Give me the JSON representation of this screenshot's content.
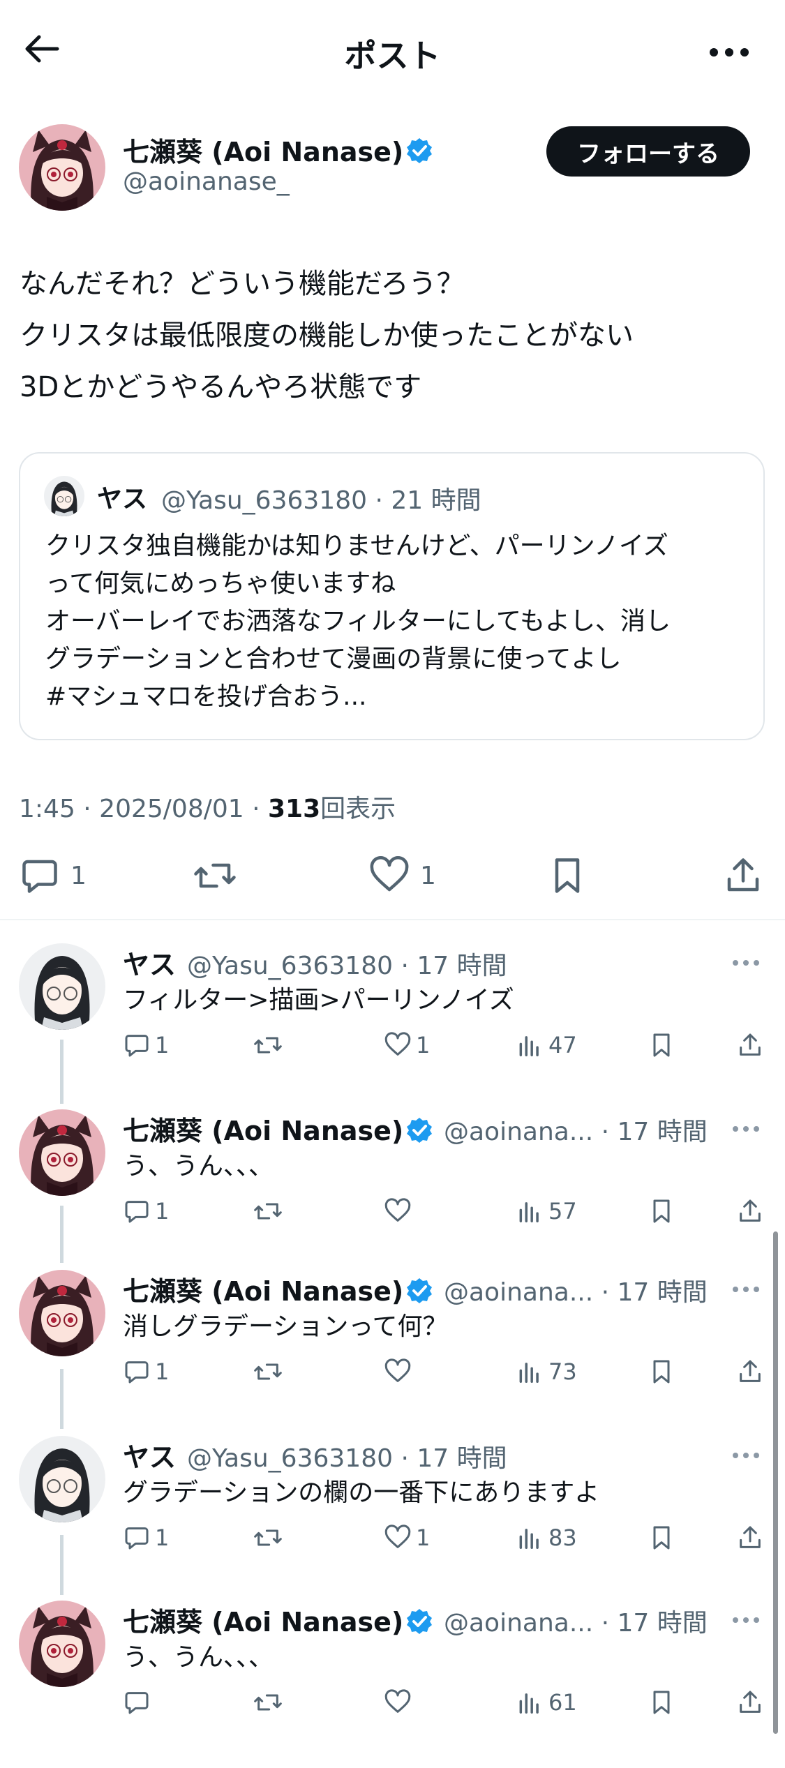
{
  "header": {
    "title": "ポスト",
    "back_icon": "arrow-left-icon",
    "more_icon": "more-horizontal-icon"
  },
  "main_post": {
    "author_name": "七瀬葵 (Aoi Nanase)",
    "handle": "@aoinanase_",
    "follow_label": "フォローする",
    "text_lines": [
      "なんだそれ？どういう機能だろう？",
      "クリスタは最低限度の機能しか使ったことがない",
      "3Dとかどうやるんやろ状態です"
    ],
    "quote": {
      "author_name": "ヤス",
      "handle_time": "@Yasu_6363180 · 21 時間",
      "text_lines": [
        "クリスタ独自機能かは知りませんけど、パーリンノイズ",
        "って何気にめっちゃ使いますね",
        "オーバーレイでお洒落なフィルターにしてもよし、消し",
        "グラデーションと合わせて漫画の背景に使ってよし",
        "#マシュマロを投げ合おう..."
      ]
    },
    "meta_time": "1:45 · 2025/08/01 · ",
    "meta_views": "313",
    "meta_views_label": "回表示",
    "stats": {
      "replies": "1",
      "likes": "1"
    }
  },
  "replies": [
    {
      "author_name": "ヤス",
      "verified": false,
      "handle_time": "@Yasu_6363180 · 17 時間",
      "text": "フィルター>描画>パーリンノイズ",
      "replies": "1",
      "likes": "1",
      "views": "47",
      "avatar": "yasu"
    },
    {
      "author_name": "七瀬葵 (Aoi Nanase)",
      "verified": true,
      "handle_time": "@aoinana... · 17 時間",
      "text": "う、うん、、、",
      "replies": "1",
      "likes": "",
      "views": "57",
      "avatar": "aoi"
    },
    {
      "author_name": "七瀬葵 (Aoi Nanase)",
      "verified": true,
      "handle_time": "@aoinana... · 17 時間",
      "text": "消しグラデーションって何？",
      "replies": "1",
      "likes": "",
      "views": "73",
      "avatar": "aoi"
    },
    {
      "author_name": "ヤス",
      "verified": false,
      "handle_time": "@Yasu_6363180 · 17 時間",
      "text": "グラデーションの欄の一番下にありますよ",
      "replies": "1",
      "likes": "1",
      "views": "83",
      "avatar": "yasu"
    },
    {
      "author_name": "七瀬葵 (Aoi Nanase)",
      "verified": true,
      "handle_time": "@aoinana... · 17 時間",
      "text": "う、うん、、、",
      "replies": "",
      "likes": "",
      "views": "61",
      "avatar": "aoi"
    }
  ],
  "colors": {
    "verified": "#1d9bf0",
    "muted": "#536471",
    "text": "#0f1419"
  }
}
